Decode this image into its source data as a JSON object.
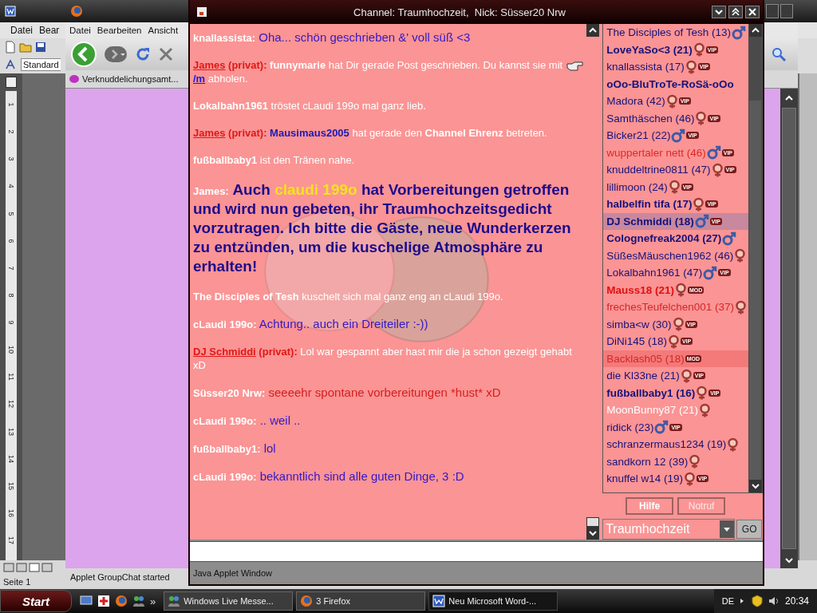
{
  "word": {
    "menu": [
      "Datei",
      "Bear"
    ],
    "style_box": "Standard",
    "ruler_numbers": [
      "1",
      "2",
      "3",
      "4",
      "5",
      "6",
      "7",
      "8",
      "9",
      "10",
      "11",
      "12",
      "13",
      "14",
      "15",
      "16",
      "17"
    ],
    "status": "Seite 1"
  },
  "firefox": {
    "menu": [
      "Datei",
      "Bearbeiten",
      "Ansicht"
    ],
    "bookmark": "Verknuddelichungsamt...",
    "status": "Applet GroupChat started"
  },
  "applet": {
    "title": "Channel: Traumhochzeit,  Nick: Süsser20 Nrw",
    "messages": [
      {
        "parts": [
          {
            "kind": "nick",
            "text": "knallassista:"
          },
          {
            "kind": "say",
            "text": " Oha... schön geschrieben &' voll süß <3",
            "color": "#3418c8"
          }
        ]
      },
      {
        "parts": [
          {
            "kind": "nick-link",
            "text": "James"
          },
          {
            "kind": "privat",
            "text": " (privat):"
          },
          {
            "kind": "info-bold",
            "text": " funnymarie"
          },
          {
            "kind": "info",
            "text": " hat Dir gerade Post geschrieben. Du kannst sie mit "
          },
          {
            "kind": "hand"
          },
          {
            "kind": "cmd-link",
            "text": "/m"
          },
          {
            "kind": "info",
            "text": " abholen."
          }
        ]
      },
      {
        "parts": [
          {
            "kind": "info-bold",
            "text": "Lokalbahn1961"
          },
          {
            "kind": "info",
            "text": " tröstet cLaudi 199o mal ganz lieb."
          }
        ]
      },
      {
        "parts": [
          {
            "kind": "nick-link",
            "text": "James"
          },
          {
            "kind": "privat",
            "text": " (privat):"
          },
          {
            "kind": "info-blue",
            "text": " Mausimaus2005"
          },
          {
            "kind": "info",
            "text": " hat gerade den "
          },
          {
            "kind": "info-bold",
            "text": "Channel Ehrenz"
          },
          {
            "kind": "info",
            "text": " betreten."
          }
        ]
      },
      {
        "parts": [
          {
            "kind": "info-bold",
            "text": "fußballbaby1"
          },
          {
            "kind": "info",
            "text": " ist den Tränen nahe."
          }
        ]
      },
      {
        "parts": [
          {
            "kind": "nick",
            "text": "James:"
          },
          {
            "kind": "shout",
            "text": " Auch ",
            "color": "#1c0c8c"
          },
          {
            "kind": "shout",
            "text": "claudi 199o",
            "color": "#f4e41c"
          },
          {
            "kind": "shout",
            "text": " hat Vorbereitungen getroffen und wird nun gebeten, ihr Traumhochzeitsgedicht vorzutragen. Ich bitte die Gäste, neue Wunderkerzen zu entzünden, um die kuschelige Atmosphäre zu erhalten!",
            "color": "#1c0c8c"
          }
        ]
      },
      {
        "parts": [
          {
            "kind": "info-bold",
            "text": "The Disciples of Tesh"
          },
          {
            "kind": "info",
            "text": " kuschelt sich mal ganz eng an cLaudi 199o."
          }
        ]
      },
      {
        "parts": [
          {
            "kind": "nick",
            "text": "cLaudi 199o:"
          },
          {
            "kind": "say",
            "text": " Achtung.. auch ein Dreiteiler :-))",
            "color": "#3418c8"
          }
        ]
      },
      {
        "parts": [
          {
            "kind": "nick-link",
            "text": "DJ Schmiddi"
          },
          {
            "kind": "privat",
            "text": " (privat):"
          },
          {
            "kind": "info",
            "text": " Lol war gespannt aber hast mir die ja schon gezeigt gehabt xD"
          }
        ]
      },
      {
        "parts": [
          {
            "kind": "nick",
            "text": "Süsser20 Nrw:"
          },
          {
            "kind": "say",
            "text": " seeeehr spontane vorbereitungen *hust* xD",
            "color": "#d42020"
          }
        ]
      },
      {
        "parts": [
          {
            "kind": "nick",
            "text": "cLaudi 199o:"
          },
          {
            "kind": "say",
            "text": " .. weil ..",
            "color": "#3418c8"
          }
        ]
      },
      {
        "parts": [
          {
            "kind": "nick",
            "text": "fußballbaby1:"
          },
          {
            "kind": "say",
            "text": " lol",
            "color": "#3418c8"
          }
        ]
      },
      {
        "parts": [
          {
            "kind": "nick",
            "text": "cLaudi 199o:"
          },
          {
            "kind": "say",
            "text": " bekanntlich sind alle guten Dinge, 3 :D",
            "color": "#3418c8"
          }
        ]
      }
    ],
    "users": [
      {
        "label": "The Disciples of Tesh (13)",
        "color": "#16127a",
        "bold": false,
        "kind": "male",
        "selected": false,
        "flagged": false
      },
      {
        "label": "LoveYaSo<3 (21)",
        "color": "#16127a",
        "bold": true,
        "kind": "female",
        "badge": "VIP",
        "selected": false,
        "flagged": false
      },
      {
        "label": "knallassista (17)",
        "color": "#16127a",
        "bold": false,
        "kind": "female",
        "badge": "VIP",
        "selected": false,
        "flagged": false
      },
      {
        "label": "oOo-BluTroTe-RoSä-oOo",
        "color": "#16127a",
        "bold": true,
        "kind": "none",
        "selected": false,
        "flagged": false
      },
      {
        "label": "Madora (42)",
        "color": "#16127a",
        "bold": false,
        "kind": "female",
        "badge": "VIP",
        "selected": false,
        "flagged": false
      },
      {
        "label": "Samthäschen (46)",
        "color": "#16127a",
        "bold": false,
        "kind": "female",
        "badge": "VIP",
        "selected": false,
        "flagged": false
      },
      {
        "label": "Bicker21 (22)",
        "color": "#16127a",
        "bold": false,
        "kind": "male",
        "badge": "VIP",
        "selected": false,
        "flagged": false
      },
      {
        "label": "wuppertaler nett (46)",
        "color": "#e02828",
        "bold": false,
        "kind": "male",
        "badge": "VIP",
        "selected": false,
        "flagged": false
      },
      {
        "label": "knuddeltrine0811 (47)",
        "color": "#16127a",
        "bold": false,
        "kind": "female",
        "badge": "VIP",
        "selected": false,
        "flagged": false
      },
      {
        "label": "lillimoon (24)",
        "color": "#16127a",
        "bold": false,
        "kind": "female",
        "badge": "VIP",
        "selected": false,
        "flagged": false
      },
      {
        "label": "halbelfin tifa (17)",
        "color": "#16127a",
        "bold": true,
        "kind": "female",
        "badge": "VIP",
        "selected": false,
        "flagged": false
      },
      {
        "label": "DJ Schmiddi (18)",
        "color": "#16127a",
        "bold": true,
        "kind": "male",
        "badge": "VIP",
        "selected": true,
        "flagged": false
      },
      {
        "label": "Colognefreak2004 (27)",
        "color": "#16127a",
        "bold": true,
        "kind": "male",
        "selected": false,
        "flagged": false
      },
      {
        "label": "SüßesMäuschen1962 (46)",
        "color": "#16127a",
        "bold": false,
        "kind": "female",
        "selected": false,
        "flagged": false
      },
      {
        "label": "Lokalbahn1961 (47)",
        "color": "#16127a",
        "bold": false,
        "kind": "male",
        "badge": "VIP",
        "selected": false,
        "flagged": false
      },
      {
        "label": "Mauss18 (21)",
        "color": "#e01010",
        "bold": true,
        "kind": "female",
        "badge": "MOD",
        "selected": false,
        "flagged": false
      },
      {
        "label": "frechesTeufelchen001 (37)",
        "color": "#d42828",
        "bold": false,
        "kind": "female",
        "selected": false,
        "flagged": false
      },
      {
        "label": "simba<w (30)",
        "color": "#16127a",
        "bold": false,
        "kind": "female",
        "badge": "VIP",
        "selected": false,
        "flagged": false
      },
      {
        "label": "DiNi145 (18)",
        "color": "#16127a",
        "bold": false,
        "kind": "female",
        "badge": "VIP",
        "selected": false,
        "flagged": false
      },
      {
        "label": "Backlash05 (18)",
        "color": "#d42828",
        "bold": false,
        "kind": "none",
        "badge": "MOD",
        "selected": false,
        "flagged": true
      },
      {
        "label": "die Kl33ne (21)",
        "color": "#16127a",
        "bold": false,
        "kind": "female",
        "badge": "VIP",
        "selected": false,
        "flagged": false
      },
      {
        "label": "fußballbaby1 (16)",
        "color": "#16127a",
        "bold": true,
        "kind": "female",
        "badge": "VIP",
        "selected": false,
        "flagged": false
      },
      {
        "label": "MoonBunny87 (21)",
        "color": "#ffffff",
        "bold": false,
        "kind": "female",
        "selected": false,
        "flagged": false
      },
      {
        "label": "ridick (23)",
        "color": "#16127a",
        "bold": false,
        "kind": "male",
        "badge": "VIP",
        "selected": false,
        "flagged": false
      },
      {
        "label": "schranzermaus1234 (19)",
        "color": "#16127a",
        "bold": false,
        "kind": "female",
        "selected": false,
        "flagged": false
      },
      {
        "label": "sandkorn 12 (39)",
        "color": "#16127a",
        "bold": false,
        "kind": "female",
        "selected": false,
        "flagged": false
      },
      {
        "label": "knuffel w14 (19)",
        "color": "#16127a",
        "bold": false,
        "kind": "female",
        "badge": "VIP",
        "selected": false,
        "flagged": false
      }
    ],
    "buttons": [
      {
        "label": "Hilfe",
        "emphasized": true
      },
      {
        "label": "Notruf",
        "emphasized": false
      }
    ],
    "channel_select": {
      "value": "Traumhochzeit"
    },
    "go_button": "GO",
    "status": "Java Applet Window"
  },
  "taskbar": {
    "start": "Start",
    "quick_launch_more": "»",
    "tasks": [
      {
        "label": "Windows Live Messe...",
        "selected": false
      },
      {
        "label": "3 Firefox",
        "selected": false
      },
      {
        "label": "Neu Microsoft Word-...",
        "selected": true
      }
    ],
    "language": "DE",
    "clock": "20:34"
  }
}
